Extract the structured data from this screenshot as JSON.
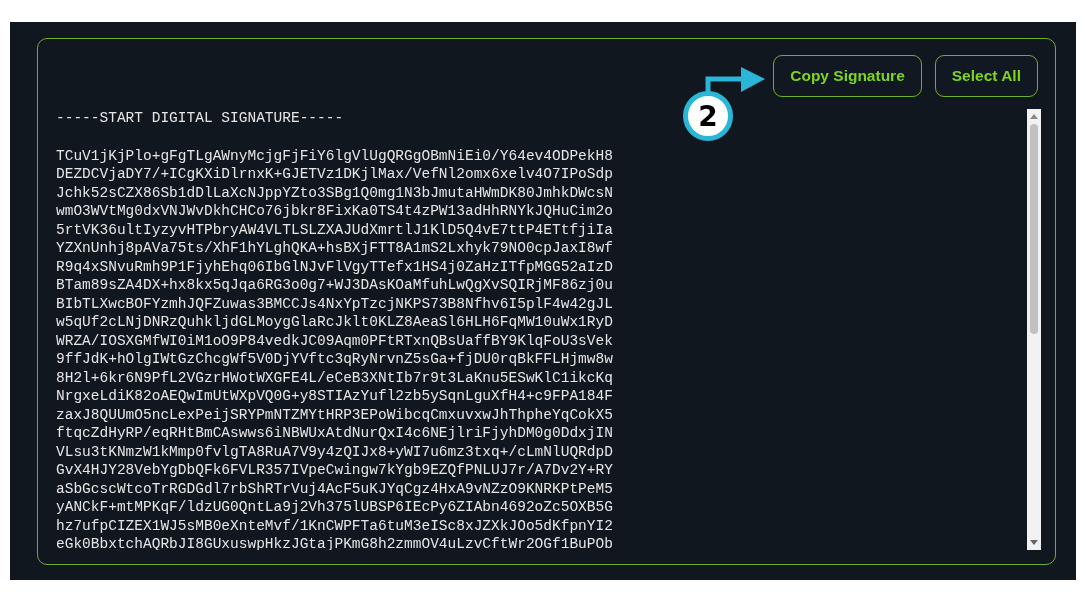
{
  "buttons": [
    {
      "label": "Copy Signature"
    },
    {
      "label": "Select All"
    }
  ],
  "callout": {
    "number": "2"
  },
  "signature": {
    "header": "-----START DIGITAL SIGNATURE-----",
    "lines": [
      "TCuV1jKjPlo+gFgTLgAWnyMcjgFjFiY6lgVlUgQRGgOBmNiEi0/Y64ev4ODPekH8",
      "DEZDCVjaDY7/+ICgKXiDlrnxK+GJETVz1DKjlMax/VefNl2omx6xelv4O7IPoSdp",
      "Jchk52sCZX86Sb1dDlLaXcNJppYZto3SBg1Q0mg1N3bJmutaHWmDK80JmhkDWcsN",
      "wmO3WVtMg0dxVNJWvDkhCHCo76jbkr8FixKa0TS4t4zPW13adHhRNYkJQHuCim2o",
      "5rtVK36ultIyzyvHTPbryAW4VLTLSLZXAJUdXmrtlJ1KlD5Q4vE7ttP4ETtfjiIa",
      "YZXnUnhj8pAVa75ts/XhF1hYLghQKA+hsBXjFTT8A1mS2Lxhyk79NO0cpJaxI8wf",
      "R9q4xSNvuRmh9P1FjyhEhq06IbGlNJvFlVgyTTefx1HS4j0ZaHzITfpMGG52aIzD",
      "BTam89sZA4DX+hx8kx5qJqa6RG3o0g7+WJ3DAsKOaMfuhLwQgXvSQIRjMF86zj0u",
      "BIbTLXwcBOFYzmhJQFZuwas3BMCCJs4NxYpTzcjNKPS73B8Nfhv6I5plF4w42gJL",
      "w5qUf2cLNjDNRzQuhkljdGLMoygGlaRcJklt0KLZ8AeaSl6HLH6FqMW10uWx1RyD",
      "WRZA/IOSXGMfWI0iM1oO9P84vedkJC09Aqm0PFtRTxnQBsUaffBY9KlqFoU3sVek",
      "9ffJdK+hOlgIWtGzChcgWf5V0DjYVftc3qRyNrvnZ5sGa+fjDU0rqBkFFLHjmw8w",
      "8H2l+6kr6N9PfL2VGzrHWotWXGFE4L/eCeB3XNtIb7r9t3LaKnu5ESwKlC1ikcKq",
      "NrgxeLdiK82oAEQwImUtWXpVQ0G+y8STIAzYufl2zb5ySqnLguXfH4+c9FPA184F",
      "zaxJ8QUUmO5ncLexPeijSRYPmNTZMYtHRP3EPoWibcqCmxuvxwJhThpheYqCokX5",
      "ftqcZdHyRP/eqRHtBmCAswws6iNBWUxAtdNurQxI4c6NEjlriFjyhDM0g0DdxjIN",
      "VLsu3tKNmzW1kMmp0fvlgTA8RuA7V9y4zQIJx8+yWI7u6mz3txq+/cLmNlUQRdpD",
      "GvX4HJY28VebYgDbQFk6FVLR357IVpeCwingw7kYgb9EZQfPNLUJ7r/A7Dv2Y+RY",
      "aSbGcscWtcoTrRGDGdl7rbShRTrVuj4AcF5uKJYqCgz4HxA9vNZzO9KNRKPtPeM5",
      "yANCkF+mtMPKqF/ldzUG0QntLa9j2Vh375lUBSP6IEcPy6ZIAbn4692oZc5OXB5G",
      "hz7ufpCIZEX1WJ5sMB0eXnteMvf/1KnCWPFTa6tuM3eISc8xJZXkJOo5dKfpnYI2",
      "eGk0BbxtchAQRbJI8GUxuswpHkzJGtajPKmG8h2zmmOV4uLzvCftWr2OGf1BuPOb"
    ]
  }
}
